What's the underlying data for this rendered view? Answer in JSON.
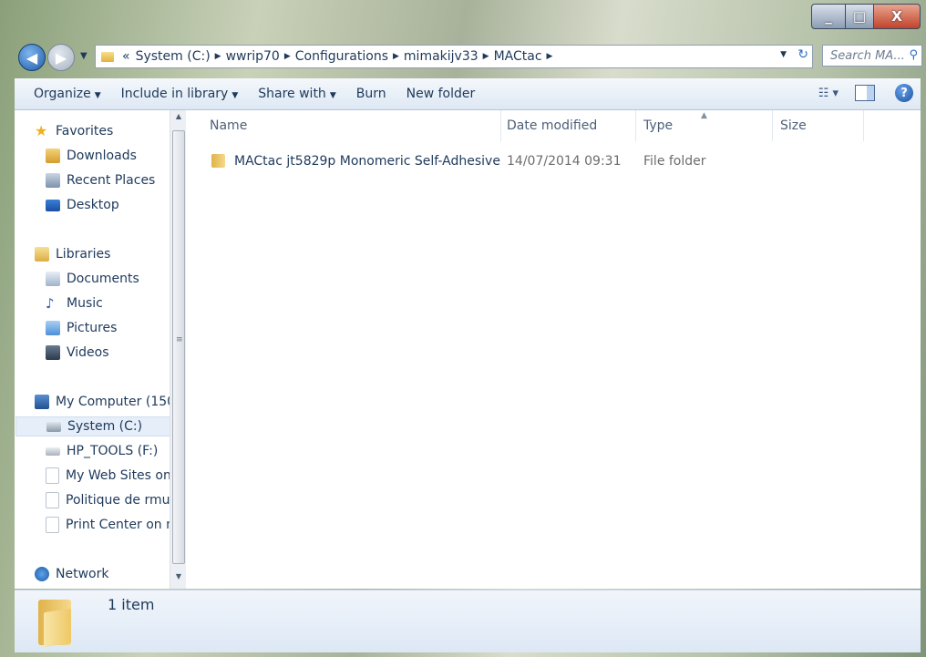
{
  "window": {
    "minimize": "_",
    "maximize": "□",
    "close": "X"
  },
  "address": {
    "overflow": "«",
    "segments": [
      "System (C:)",
      "wwrip70",
      "Configurations",
      "mimakijv33",
      "MACtac"
    ]
  },
  "search": {
    "placeholder": "Search MA..."
  },
  "toolbar": {
    "organize": "Organize",
    "include_in_library": "Include in library",
    "share_with": "Share with",
    "burn": "Burn",
    "new_folder": "New folder"
  },
  "nav": {
    "favorites": "Favorites",
    "downloads": "Downloads",
    "recent_places": "Recent Places",
    "desktop": "Desktop",
    "libraries": "Libraries",
    "documents": "Documents",
    "music": "Music",
    "pictures": "Pictures",
    "videos": "Videos",
    "my_computer": "My Computer (150",
    "system_c": "System (C:)",
    "hp_tools": "HP_TOOLS (F:)",
    "my_web_sites": "My Web Sites on",
    "politique": "Politique de rmu",
    "print_center": "Print Center on n",
    "network": "Network"
  },
  "columns": {
    "name": "Name",
    "date_modified": "Date modified",
    "type": "Type",
    "size": "Size"
  },
  "files": [
    {
      "name": "MACtac jt5829p Monomeric Self-Adhesive",
      "date": "14/07/2014 09:31",
      "type": "File folder",
      "size": ""
    }
  ],
  "status": {
    "item_count": "1 item"
  },
  "icons": {
    "folder": "folder-icon",
    "favorites": "star-icon",
    "libraries": "library-icon",
    "computer": "computer-icon",
    "network": "network-icon"
  }
}
